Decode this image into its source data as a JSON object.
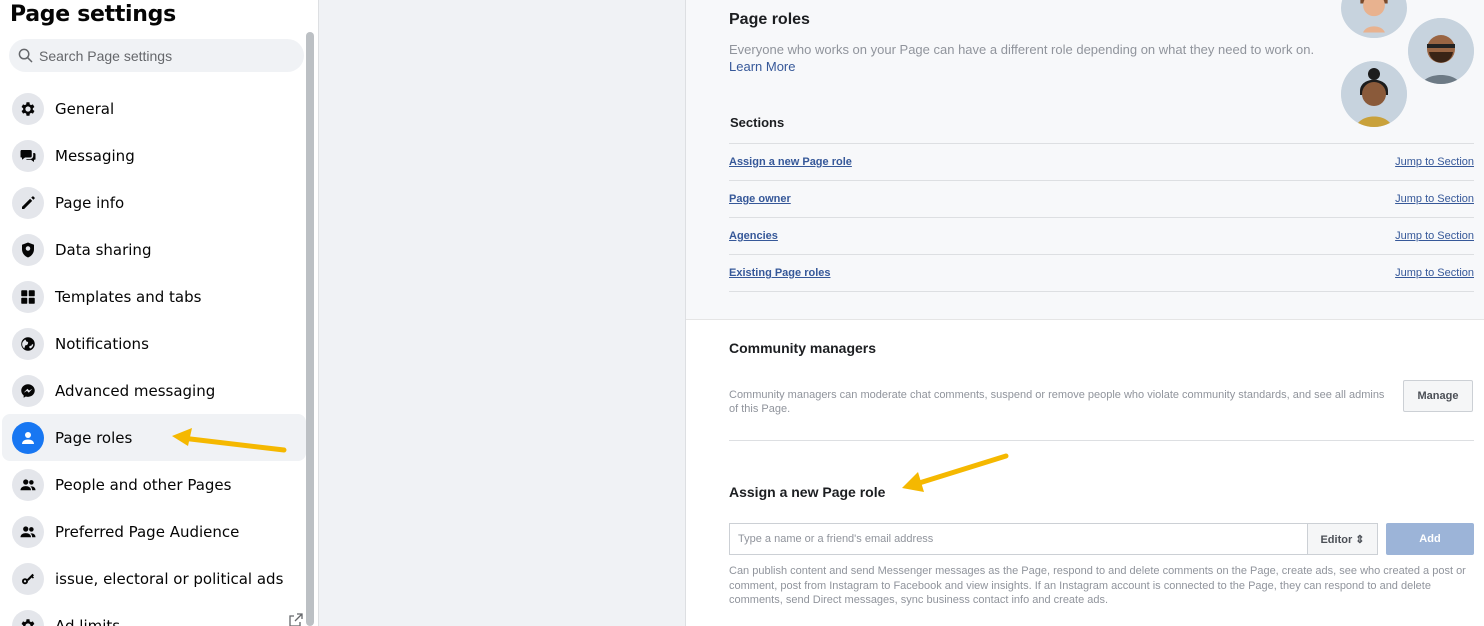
{
  "sidebar": {
    "title": "Page settings",
    "search_placeholder": "Search Page settings",
    "items": [
      {
        "label": "General",
        "icon": "gear-icon"
      },
      {
        "label": "Messaging",
        "icon": "chat-bubbles-icon"
      },
      {
        "label": "Page info",
        "icon": "pencil-icon"
      },
      {
        "label": "Data sharing",
        "icon": "shield-icon"
      },
      {
        "label": "Templates and tabs",
        "icon": "grid-icon"
      },
      {
        "label": "Notifications",
        "icon": "globe-icon"
      },
      {
        "label": "Advanced messaging",
        "icon": "messenger-icon"
      },
      {
        "label": "Page roles",
        "icon": "person-icon",
        "active": true
      },
      {
        "label": "People and other Pages",
        "icon": "people-icon"
      },
      {
        "label": "Preferred Page Audience",
        "icon": "people-icon"
      },
      {
        "label": "issue, electoral or political ads",
        "icon": "key-icon"
      },
      {
        "label": "Ad limits",
        "icon": "gear-icon"
      }
    ]
  },
  "roles": {
    "title": "Page roles",
    "description": "Everyone who works on your Page can have a different role depending on what they need to work on.",
    "learn_more": "Learn More",
    "sections_title": "Sections",
    "sections": [
      {
        "name": "Assign a new Page role",
        "jump": "Jump to Section"
      },
      {
        "name": "Page owner",
        "jump": "Jump to Section"
      },
      {
        "name": "Agencies",
        "jump": "Jump to Section"
      },
      {
        "name": "Existing Page roles",
        "jump": "Jump to Section"
      }
    ]
  },
  "community": {
    "title": "Community managers",
    "description": "Community managers can moderate chat comments, suspend or remove people who violate community standards, and see all admins of this Page.",
    "manage_label": "Manage"
  },
  "assign": {
    "title": "Assign a new Page role",
    "input_placeholder": "Type a name or a friend's email address",
    "role_label": "Editor ⇕",
    "add_label": "Add",
    "description": "Can publish content and send Messenger messages as the Page, respond to and delete comments on the Page, create ads, see who created a post or comment, post from Instagram to Facebook and view insights. If an Instagram account is connected to the Page, they can respond to and delete comments, send Direct messages, sync business contact info and create ads."
  },
  "colors": {
    "accent": "#1877f2",
    "link": "#365899",
    "annotation_arrow": "#f5b800"
  }
}
